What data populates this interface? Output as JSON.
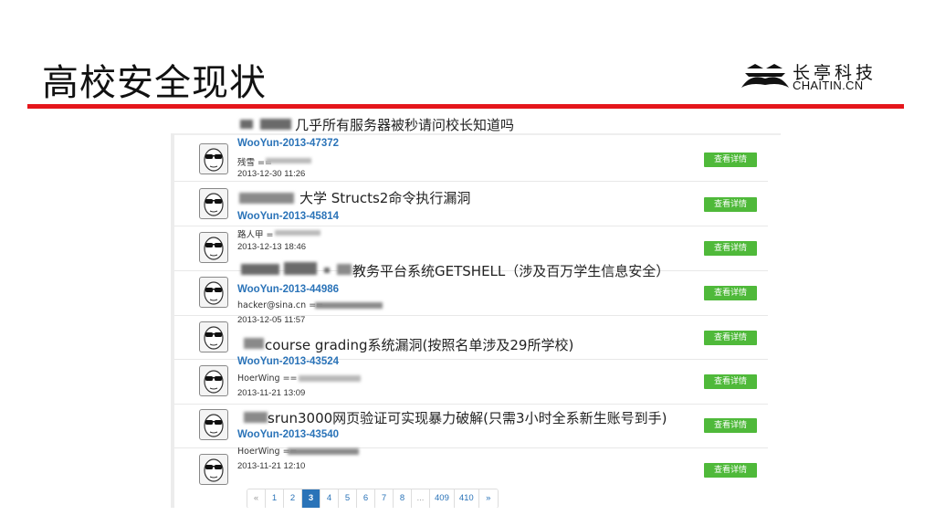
{
  "slide": {
    "title": "高校安全现状",
    "logo_cn": "长亭科技",
    "logo_en": "CHAITIN.CN",
    "accent_color": "#e5161b"
  },
  "list": {
    "detail_label": "查看详情",
    "button_color": "#4fb93a",
    "link_color": "#2a73b8",
    "items": [
      {
        "title": "几乎所有服务器被秒请问校长知道吗",
        "id": "WooYun-2013-47372",
        "author": "残雪 ==",
        "date": "2013-12-30 11:26"
      },
      {
        "title": "大学 Structs2命令执行漏洞",
        "id": "WooYun-2013-45814",
        "author": "路人甲 =",
        "date": "2013-12-13 18:46"
      },
      {
        "title": "教务平台系统GETSHELL（涉及百万学生信息安全）",
        "id": "WooYun-2013-44986",
        "author": "hacker@sina.cn ==",
        "date": "2013-12-05 11:57"
      },
      {
        "title": "course grading系统漏洞(按照名单涉及29所学校)",
        "id": "WooYun-2013-43524",
        "author": "HoerWing ==",
        "date": "2013-11-21 13:09"
      },
      {
        "title": "srun3000网页验证可实现暴力破解(只需3小时全系新生账号到手)",
        "id": "WooYun-2013-43540",
        "author": "HoerWing ==",
        "date": "2013-11-21 12:10"
      }
    ]
  },
  "pagination": {
    "items": [
      "«",
      "1",
      "2",
      "3",
      "4",
      "5",
      "6",
      "7",
      "8",
      "...",
      "409",
      "410",
      "»"
    ],
    "active": "3"
  }
}
